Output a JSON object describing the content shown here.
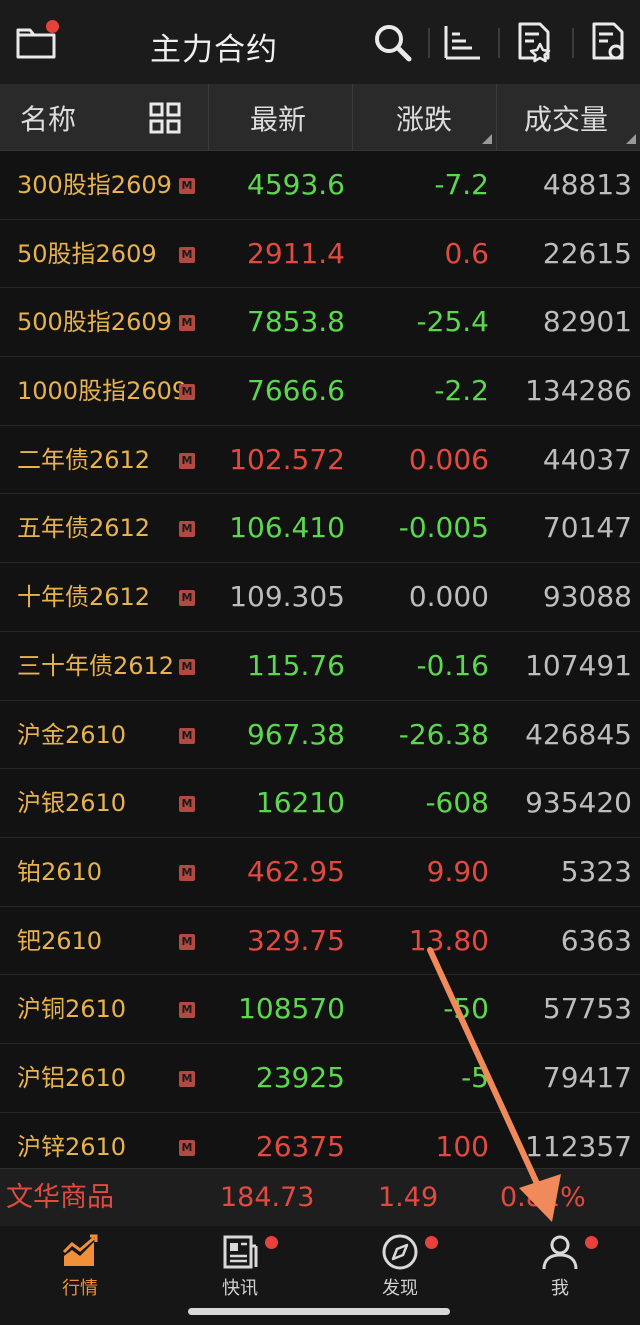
{
  "app": {
    "title": "主力合约"
  },
  "header": {
    "name": "名称",
    "last": "最新",
    "change": "涨跌",
    "volume": "成交量"
  },
  "rows": [
    {
      "name": "300股指2609",
      "last": "4593.6",
      "change": "-7.2",
      "volume": "48813",
      "dir": "down"
    },
    {
      "name": "50股指2609",
      "last": "2911.4",
      "change": "0.6",
      "volume": "22615",
      "dir": "up"
    },
    {
      "name": "500股指2609",
      "last": "7853.8",
      "change": "-25.4",
      "volume": "82901",
      "dir": "down"
    },
    {
      "name": "1000股指2609",
      "last": "7666.6",
      "change": "-2.2",
      "volume": "134286",
      "dir": "down"
    },
    {
      "name": "二年债2612",
      "last": "102.572",
      "change": "0.006",
      "volume": "44037",
      "dir": "up"
    },
    {
      "name": "五年债2612",
      "last": "106.410",
      "change": "-0.005",
      "volume": "70147",
      "dir": "down"
    },
    {
      "name": "十年债2612",
      "last": "109.305",
      "change": "0.000",
      "volume": "93088",
      "dir": "flat"
    },
    {
      "name": "三十年债2612",
      "last": "115.76",
      "change": "-0.16",
      "volume": "107491",
      "dir": "down"
    },
    {
      "name": "沪金2610",
      "last": "967.38",
      "change": "-26.38",
      "volume": "426845",
      "dir": "down"
    },
    {
      "name": "沪银2610",
      "last": "16210",
      "change": "-608",
      "volume": "935420",
      "dir": "down"
    },
    {
      "name": "铂2610",
      "last": "462.95",
      "change": "9.90",
      "volume": "5323",
      "dir": "up"
    },
    {
      "name": "钯2610",
      "last": "329.75",
      "change": "13.80",
      "volume": "6363",
      "dir": "up"
    },
    {
      "name": "沪铜2610",
      "last": "108570",
      "change": "-50",
      "volume": "57753",
      "dir": "down"
    },
    {
      "name": "沪铝2610",
      "last": "23925",
      "change": "-5",
      "volume": "79417",
      "dir": "down"
    },
    {
      "name": "沪锌2610",
      "last": "26375",
      "change": "100",
      "volume": "112357",
      "dir": "up"
    }
  ],
  "badge": "M",
  "ticker": {
    "name": "文华商品",
    "last": "184.73",
    "change": "1.49",
    "percent": "0.81%"
  },
  "nav": [
    {
      "label": "行情",
      "icon": "market-chart-icon"
    },
    {
      "label": "快讯",
      "icon": "news-icon"
    },
    {
      "label": "发现",
      "icon": "compass-icon"
    },
    {
      "label": "我",
      "icon": "user-icon"
    }
  ],
  "colors": {
    "up": "#e14a40",
    "down": "#5cd84f",
    "name": "#e8b34f",
    "accent": "#f2903a",
    "arrow": "#f08a5a"
  }
}
